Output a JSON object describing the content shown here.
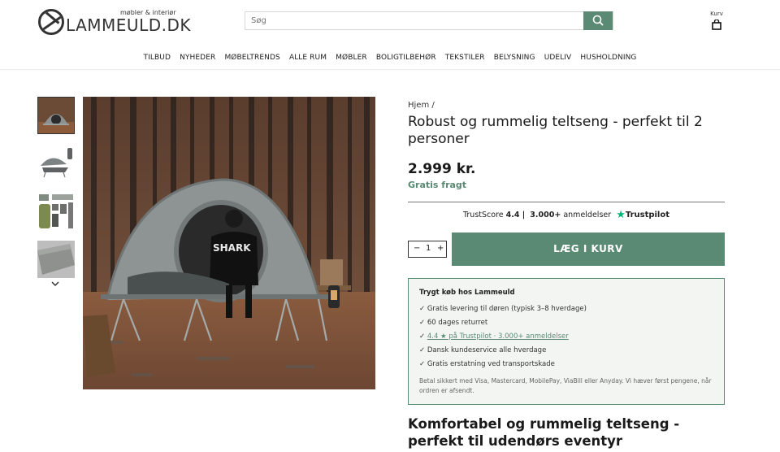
{
  "header": {
    "logo_text": "LAMMEULD.DK",
    "logo_tagline": "møbler & interiør",
    "search_placeholder": "Søg",
    "cart_label": "Kurv"
  },
  "nav": [
    "TILBUD",
    "NYHEDER",
    "MØBELTRENDS",
    "ALLE RUM",
    "MØBLER",
    "BOLIGTILBEHØR",
    "TEKSTILER",
    "BELYSNING",
    "UDELIV",
    "HUSHOLDNING"
  ],
  "product": {
    "breadcrumb": "Hjem /",
    "title": "Robust og rummelig teltseng - perfekt til 2 personer",
    "price": "2.999 kr.",
    "shipping": "Gratis fragt",
    "quantity": "1",
    "add_to_cart": "LÆG I KURV",
    "image_print": "SHARK"
  },
  "trust": {
    "prefix": "TrustScore",
    "score": "4.4 |",
    "count": "3.000+",
    "suffix": "anmeldelser",
    "brand": "Trustpilot"
  },
  "safe_buy": {
    "heading": "Trygt køb hos Lammeuld",
    "items": [
      "✓ Gratis levering til døren (typisk 3–8 hverdage)",
      "✓ 60 dages returret",
      "✓ Dansk kundeservice alle hverdage",
      "✓ Gratis erstatning ved transportskade"
    ],
    "trust_check": "✓",
    "trust_link": "4.4 ★ på Trustpilot · 3.000+ anmeldelser",
    "note": "Betal sikkert med Visa, Mastercard, MobilePay, ViaBill eller Anyday. Vi hæver først pengene, når ordren er afsendt."
  },
  "description": {
    "heading": "Komfortabel og rummelig teltseng - perfekt til udendørs eventyr"
  },
  "colors": {
    "accent": "#5a8a73",
    "trust_star": "#00b67a",
    "safe_bg": "#f2f5f2"
  },
  "icons": [
    "search-icon",
    "cart-icon",
    "chevron-down-icon",
    "trustpilot-star-icon"
  ]
}
